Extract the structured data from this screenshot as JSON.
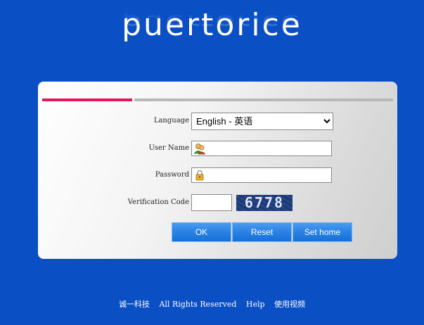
{
  "brand": {
    "logo_text": "puertorice"
  },
  "form": {
    "language_label": "Language",
    "language_selected": "English - 英语",
    "username_label": "User Name",
    "username_value": "",
    "password_label": "Password",
    "password_value": "",
    "verification_label": "Verification Code",
    "verification_value": "",
    "captcha_text": "6778"
  },
  "buttons": {
    "ok": "OK",
    "reset": "Reset",
    "set_home": "Set home"
  },
  "footer": {
    "company": "诚一科技",
    "rights": "All Rights Reserved",
    "help": "Help",
    "video": "使用视频"
  },
  "colors": {
    "background": "#0a4fc4",
    "accent_bar": "#e8145a",
    "button": "#2a82e4"
  },
  "icons": {
    "username": "user-icon",
    "password": "lock-icon"
  }
}
